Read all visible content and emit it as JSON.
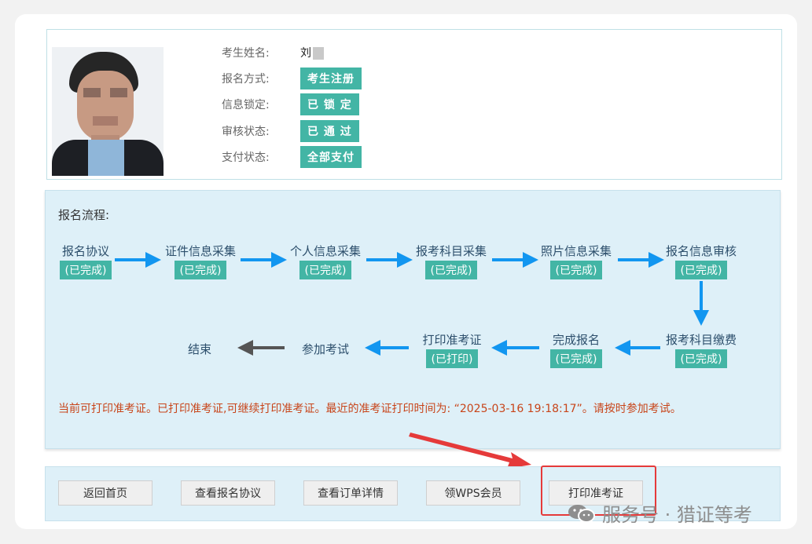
{
  "candidate": {
    "name_label": "考生姓名:",
    "name_value": "刘",
    "method_label": "报名方式:",
    "method_value": "考生注册",
    "lock_label": "信息锁定:",
    "lock_value": "已 锁 定",
    "review_label": "审核状态:",
    "review_value": "已 通 过",
    "payment_label": "支付状态:",
    "payment_value": "全部支付"
  },
  "flow": {
    "title": "报名流程:",
    "steps": [
      {
        "name": "报名协议",
        "status": "(已完成)"
      },
      {
        "name": "证件信息采集",
        "status": "(已完成)"
      },
      {
        "name": "个人信息采集",
        "status": "(已完成)"
      },
      {
        "name": "报考科目采集",
        "status": "(已完成)"
      },
      {
        "name": "照片信息采集",
        "status": "(已完成)"
      },
      {
        "name": "报名信息审核",
        "status": "(已完成)"
      },
      {
        "name": "报考科目缴费",
        "status": "(已完成)"
      },
      {
        "name": "完成报名",
        "status": "(已完成)"
      },
      {
        "name": "打印准考证",
        "status": "(已打印)"
      },
      {
        "name": "参加考试",
        "status": ""
      },
      {
        "name": "结束",
        "status": ""
      }
    ],
    "notice": "当前可打印准考证。已打印准考证,可继续打印准考证。最近的准考证打印时间为: “2025-03-16 19:18:17”。请按时参加考试。"
  },
  "actions": {
    "home": "返回首页",
    "agreement": "查看报名协议",
    "order": "查看订单详情",
    "wps": "领WPS会员",
    "print": "打印准考证"
  },
  "watermark": {
    "text": "服务号 · 猎证等考"
  },
  "colors": {
    "badge": "#43b5a5",
    "arrow": "#1296f0",
    "notice": "#c8451a",
    "highlight": "#e53a3a"
  }
}
